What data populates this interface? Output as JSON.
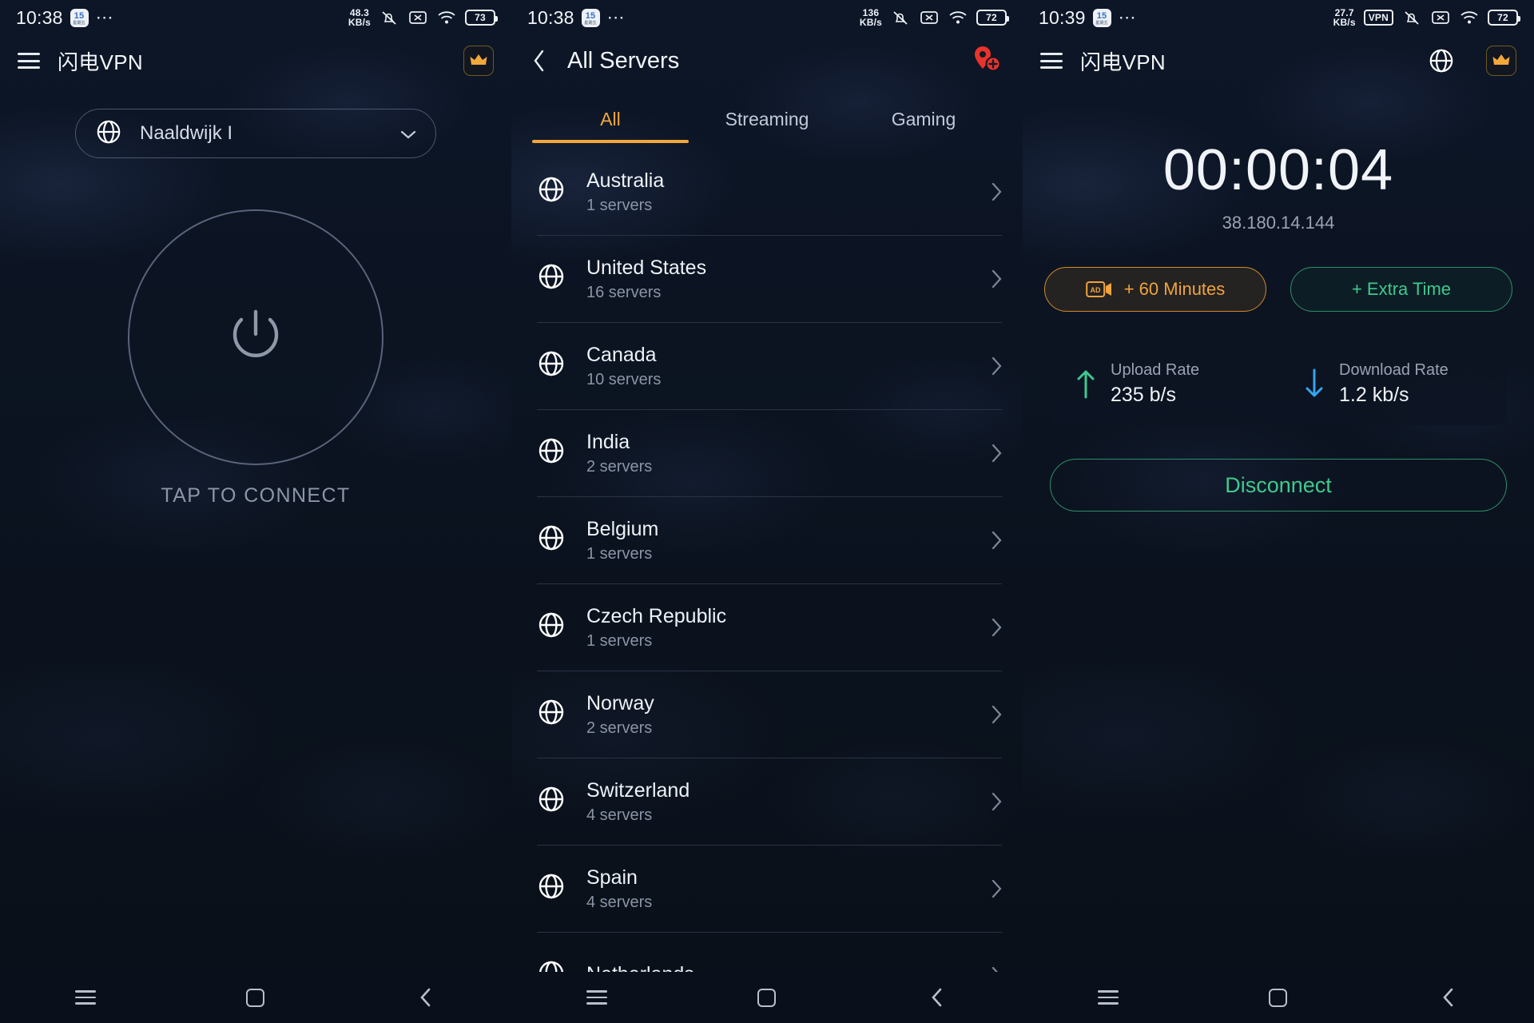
{
  "accent": {
    "orange": "#f2a73b",
    "green": "#3fc98d",
    "blue": "#34a5f0",
    "red": "#e8342c"
  },
  "panel1": {
    "status": {
      "time": "10:38",
      "cal_day": "15",
      "cal_sub": "星期五",
      "dots": "⋯",
      "speed": "48.3",
      "speed_unit": "KB/s",
      "battery": "73"
    },
    "appbar": {
      "title": "闪电VPN",
      "menu_icon": "hamburger-icon",
      "crown_icon": "crown-icon"
    },
    "location": {
      "icon": "globe-icon",
      "name": "Naaldwijk I",
      "chevron": "chevron-down-icon"
    },
    "connect": {
      "icon": "power-icon",
      "label": "TAP TO CONNECT"
    },
    "nav": {
      "recents": "recents-icon",
      "home": "home-icon",
      "back": "back-icon"
    }
  },
  "panel2": {
    "status": {
      "time": "10:38",
      "cal_day": "15",
      "cal_sub": "星期五",
      "dots": "⋯",
      "speed": "136",
      "speed_unit": "KB/s",
      "battery": "72"
    },
    "appbar": {
      "back_icon": "back-chevron-icon",
      "title": "All Servers",
      "pin_icon": "add-location-pin-icon"
    },
    "tabs": [
      {
        "label": "All",
        "active": true
      },
      {
        "label": "Streaming",
        "active": false
      },
      {
        "label": "Gaming",
        "active": false
      }
    ],
    "servers": [
      {
        "name": "Australia",
        "count": "1 servers"
      },
      {
        "name": "United States",
        "count": "16 servers"
      },
      {
        "name": "Canada",
        "count": "10 servers"
      },
      {
        "name": "India",
        "count": "2 servers"
      },
      {
        "name": "Belgium",
        "count": "1 servers"
      },
      {
        "name": "Czech Republic",
        "count": "1 servers"
      },
      {
        "name": "Norway",
        "count": "2 servers"
      },
      {
        "name": "Switzerland",
        "count": "4 servers"
      },
      {
        "name": "Spain",
        "count": "4 servers"
      },
      {
        "name": "Netherlands",
        "count": ""
      }
    ],
    "nav": {
      "recents": "recents-icon",
      "home": "home-icon",
      "back": "back-icon"
    }
  },
  "panel3": {
    "status": {
      "time": "10:39",
      "cal_day": "15",
      "cal_sub": "星期五",
      "dots": "⋯",
      "speed": "27.7",
      "speed_unit": "KB/s",
      "vpn_badge": "VPN",
      "battery": "72"
    },
    "appbar": {
      "title": "闪电VPN",
      "menu_icon": "hamburger-icon",
      "globe_icon": "globe-icon",
      "crown_icon": "crown-icon"
    },
    "session": {
      "timer": "00:00:04",
      "ip": "38.180.14.144"
    },
    "buttons": {
      "ad_minutes": "+ 60 Minutes",
      "ad_badge": "AD",
      "extra_time": "+ Extra Time",
      "disconnect": "Disconnect"
    },
    "rates": {
      "upload_label": "Upload Rate",
      "upload_value": "235 b/s",
      "download_label": "Download Rate",
      "download_value": "1.2 kb/s"
    },
    "nav": {
      "recents": "recents-icon",
      "home": "home-icon",
      "back": "back-icon"
    }
  }
}
